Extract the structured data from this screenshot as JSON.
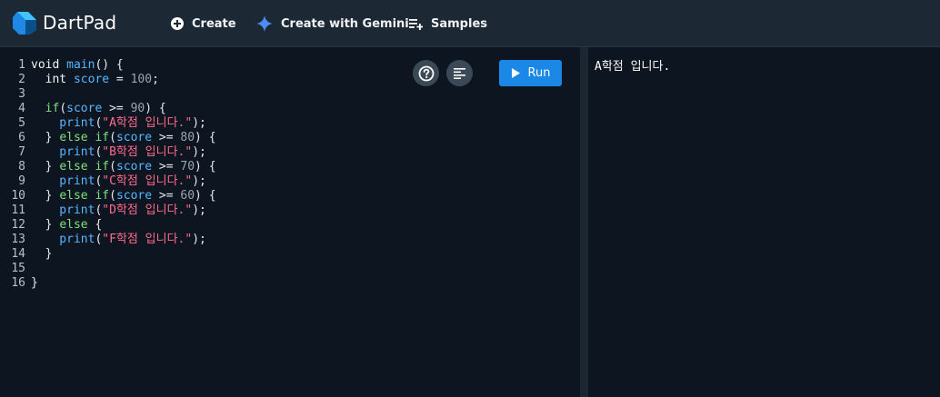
{
  "app": {
    "title": "DartPad"
  },
  "nav": {
    "create": "Create",
    "create_gemini": "Create with Gemini",
    "samples": "Samples"
  },
  "toolbar": {
    "run_label": "Run"
  },
  "editor": {
    "lines": [
      {
        "n": "1",
        "tokens": [
          [
            "k",
            "void "
          ],
          [
            "f",
            "main"
          ],
          [
            "p",
            "() {"
          ]
        ]
      },
      {
        "n": "2",
        "tokens": [
          [
            "k",
            "  int "
          ],
          [
            "v",
            "score"
          ],
          [
            "p",
            " = "
          ],
          [
            "n",
            "100"
          ],
          [
            "p",
            ";"
          ]
        ]
      },
      {
        "n": "3",
        "tokens": []
      },
      {
        "n": "4",
        "tokens": [
          [
            "kw",
            "  if"
          ],
          [
            "p",
            "("
          ],
          [
            "v",
            "score"
          ],
          [
            "p",
            " >= "
          ],
          [
            "n",
            "90"
          ],
          [
            "p",
            ") {"
          ]
        ]
      },
      {
        "n": "5",
        "tokens": [
          [
            "f",
            "    print"
          ],
          [
            "p",
            "("
          ],
          [
            "s",
            "\"A학점 입니다.\""
          ],
          [
            "p",
            ");"
          ]
        ]
      },
      {
        "n": "6",
        "tokens": [
          [
            "p",
            "  } "
          ],
          [
            "kw",
            "else if"
          ],
          [
            "p",
            "("
          ],
          [
            "v",
            "score"
          ],
          [
            "p",
            " >= "
          ],
          [
            "n",
            "80"
          ],
          [
            "p",
            ") {"
          ]
        ]
      },
      {
        "n": "7",
        "tokens": [
          [
            "f",
            "    print"
          ],
          [
            "p",
            "("
          ],
          [
            "s",
            "\"B학점 입니다.\""
          ],
          [
            "p",
            ");"
          ]
        ]
      },
      {
        "n": "8",
        "tokens": [
          [
            "p",
            "  } "
          ],
          [
            "kw",
            "else if"
          ],
          [
            "p",
            "("
          ],
          [
            "v",
            "score"
          ],
          [
            "p",
            " >= "
          ],
          [
            "n",
            "70"
          ],
          [
            "p",
            ") {"
          ]
        ]
      },
      {
        "n": "9",
        "tokens": [
          [
            "f",
            "    print"
          ],
          [
            "p",
            "("
          ],
          [
            "s",
            "\"C학점 입니다.\""
          ],
          [
            "p",
            ");"
          ]
        ]
      },
      {
        "n": "10",
        "tokens": [
          [
            "p",
            "  } "
          ],
          [
            "kw",
            "else if"
          ],
          [
            "p",
            "("
          ],
          [
            "v",
            "score"
          ],
          [
            "p",
            " >= "
          ],
          [
            "n",
            "60"
          ],
          [
            "p",
            ") {"
          ]
        ]
      },
      {
        "n": "11",
        "tokens": [
          [
            "f",
            "    print"
          ],
          [
            "p",
            "("
          ],
          [
            "s",
            "\"D학점 입니다.\""
          ],
          [
            "p",
            ");"
          ]
        ]
      },
      {
        "n": "12",
        "tokens": [
          [
            "p",
            "  } "
          ],
          [
            "kw",
            "else"
          ],
          [
            "p",
            " {"
          ]
        ]
      },
      {
        "n": "13",
        "tokens": [
          [
            "f",
            "    print"
          ],
          [
            "p",
            "("
          ],
          [
            "s",
            "\"F학점 입니다.\""
          ],
          [
            "p",
            ");"
          ]
        ]
      },
      {
        "n": "14",
        "tokens": [
          [
            "p",
            "  }"
          ]
        ]
      },
      {
        "n": "15",
        "tokens": []
      },
      {
        "n": "16",
        "tokens": [
          [
            "p",
            "}"
          ]
        ]
      }
    ]
  },
  "output": {
    "text": "A학점 입니다."
  },
  "icons": {
    "logo": "dart-logo-icon",
    "create": "plus-circle-icon",
    "gemini": "sparkle-icon",
    "samples": "playlist-add-icon",
    "help": "help-icon",
    "format": "format-align-icon",
    "run": "play-icon"
  },
  "colors": {
    "accent": "#1b87e6",
    "gemini": "#4d8df6",
    "background": "#0d1520",
    "topbar": "#1c2834"
  }
}
